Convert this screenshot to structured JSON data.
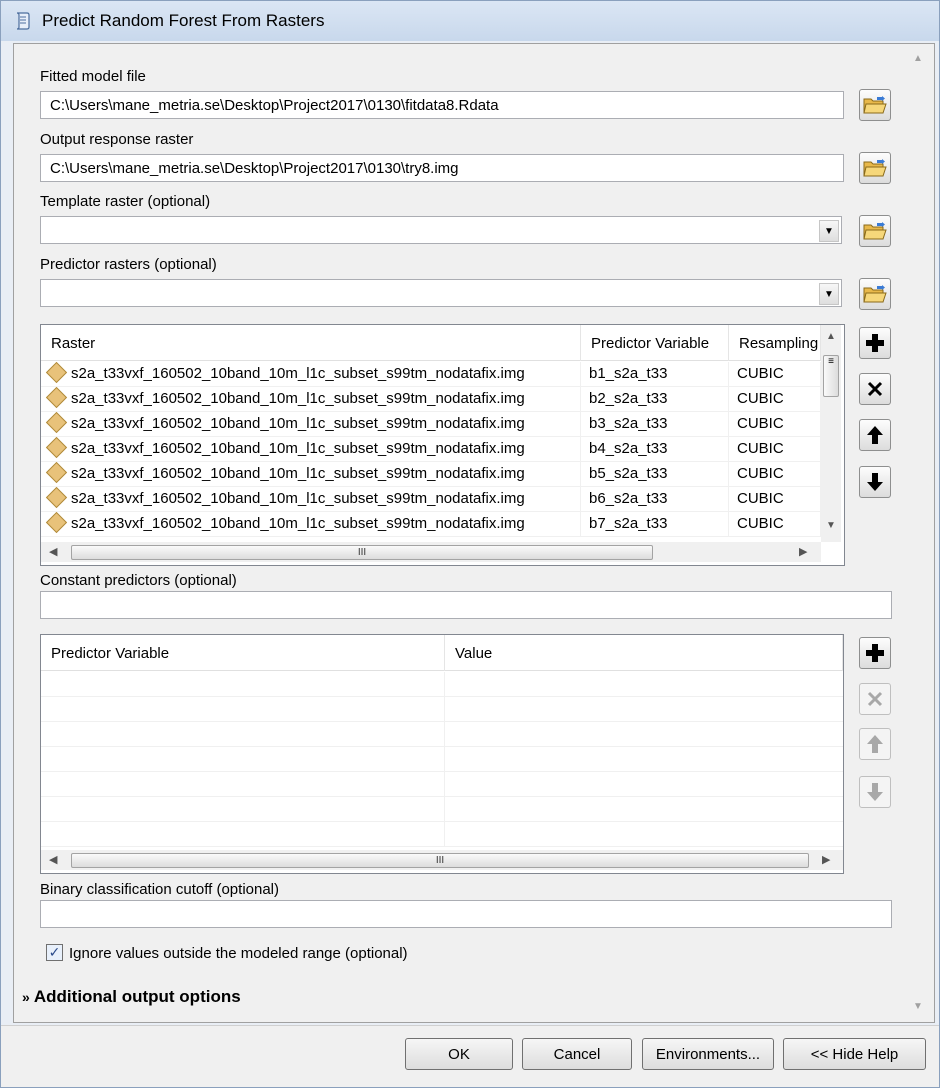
{
  "window": {
    "title": "Predict Random Forest From Rasters"
  },
  "fields": {
    "fitted_model": {
      "label": "Fitted model file",
      "value": "C:\\Users\\mane_metria.se\\Desktop\\Project2017\\0130\\fitdata8.Rdata"
    },
    "output_response": {
      "label": "Output response raster",
      "value": "C:\\Users\\mane_metria.se\\Desktop\\Project2017\\0130\\try8.img"
    },
    "template_raster": {
      "label": "Template raster (optional)",
      "value": ""
    },
    "predictor_rasters": {
      "label": "Predictor rasters (optional)",
      "value": ""
    },
    "constant_predictors": {
      "label": "Constant predictors (optional)",
      "value": ""
    },
    "binary_cutoff": {
      "label": "Binary classification cutoff (optional)",
      "value": ""
    }
  },
  "raster_table": {
    "columns": [
      "Raster",
      "Predictor Variable",
      "Resampling"
    ],
    "rows": [
      {
        "raster": "s2a_t33vxf_160502_10band_10m_l1c_subset_s99tm_nodatafix.img",
        "variable": "b1_s2a_t33",
        "resampling": "CUBIC"
      },
      {
        "raster": "s2a_t33vxf_160502_10band_10m_l1c_subset_s99tm_nodatafix.img",
        "variable": "b2_s2a_t33",
        "resampling": "CUBIC"
      },
      {
        "raster": "s2a_t33vxf_160502_10band_10m_l1c_subset_s99tm_nodatafix.img",
        "variable": "b3_s2a_t33",
        "resampling": "CUBIC"
      },
      {
        "raster": "s2a_t33vxf_160502_10band_10m_l1c_subset_s99tm_nodatafix.img",
        "variable": "b4_s2a_t33",
        "resampling": "CUBIC"
      },
      {
        "raster": "s2a_t33vxf_160502_10band_10m_l1c_subset_s99tm_nodatafix.img",
        "variable": "b5_s2a_t33",
        "resampling": "CUBIC"
      },
      {
        "raster": "s2a_t33vxf_160502_10band_10m_l1c_subset_s99tm_nodatafix.img",
        "variable": "b6_s2a_t33",
        "resampling": "CUBIC"
      },
      {
        "raster": "s2a_t33vxf_160502_10band_10m_l1c_subset_s99tm_nodatafix.img",
        "variable": "b7_s2a_t33",
        "resampling": "CUBIC"
      }
    ],
    "scroll_thumb_glyph": "III"
  },
  "constant_table": {
    "columns": [
      "Predictor Variable",
      "Value"
    ],
    "scroll_thumb_glyph": "III"
  },
  "ignore_checkbox": {
    "label": "Ignore values outside the modeled range (optional)",
    "checked": true,
    "mark": "✓"
  },
  "section": {
    "label": "Additional output options",
    "icon": "double-chevron-down-icon"
  },
  "buttons": {
    "ok": "OK",
    "cancel": "Cancel",
    "environments": "Environments...",
    "hide_help": "<< Hide Help"
  },
  "icons": [
    "script-tool-icon",
    "folder-open-icon",
    "plus-icon",
    "delete-x-icon",
    "arrow-up-icon",
    "arrow-down-icon"
  ]
}
